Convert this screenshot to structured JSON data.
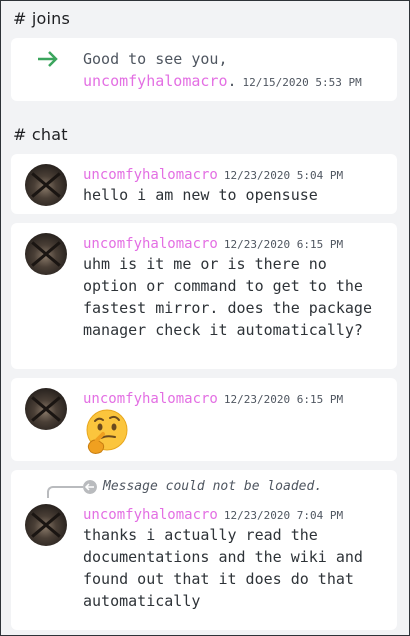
{
  "sections": {
    "joins_title": "# joins",
    "chat_title": "# chat"
  },
  "join": {
    "text_line1": "Good to see you,",
    "username": "uncomfyhalomacro",
    "suffix": ".",
    "timestamp": "12/15/2020 5:53 PM",
    "icon": "arrow-right-icon",
    "icon_color": "#3ba55d"
  },
  "messages": [
    {
      "username": "uncomfyhalomacro",
      "timestamp": "12/23/2020 5:04 PM",
      "text": "hello i am new to opensuse"
    },
    {
      "username": "uncomfyhalomacro",
      "timestamp": "12/23/2020 6:15 PM",
      "text": "uhm is it me or is there no option or command to get to the fastest mirror. does the package manager check it automatically?"
    },
    {
      "username": "uncomfyhalomacro",
      "timestamp": "12/23/2020 6:15 PM",
      "emoji": "thinking-face-icon"
    },
    {
      "reply_text": "Message could not be loaded.",
      "username": "uncomfyhalomacro",
      "timestamp": "12/23/2020 7:04 PM",
      "text": "thanks i actually read the documentations and the wiki and found out that it does do that automatically"
    }
  ],
  "colors": {
    "username": "#e36fe3",
    "background": "#f2f3f5",
    "card": "#ffffff"
  }
}
